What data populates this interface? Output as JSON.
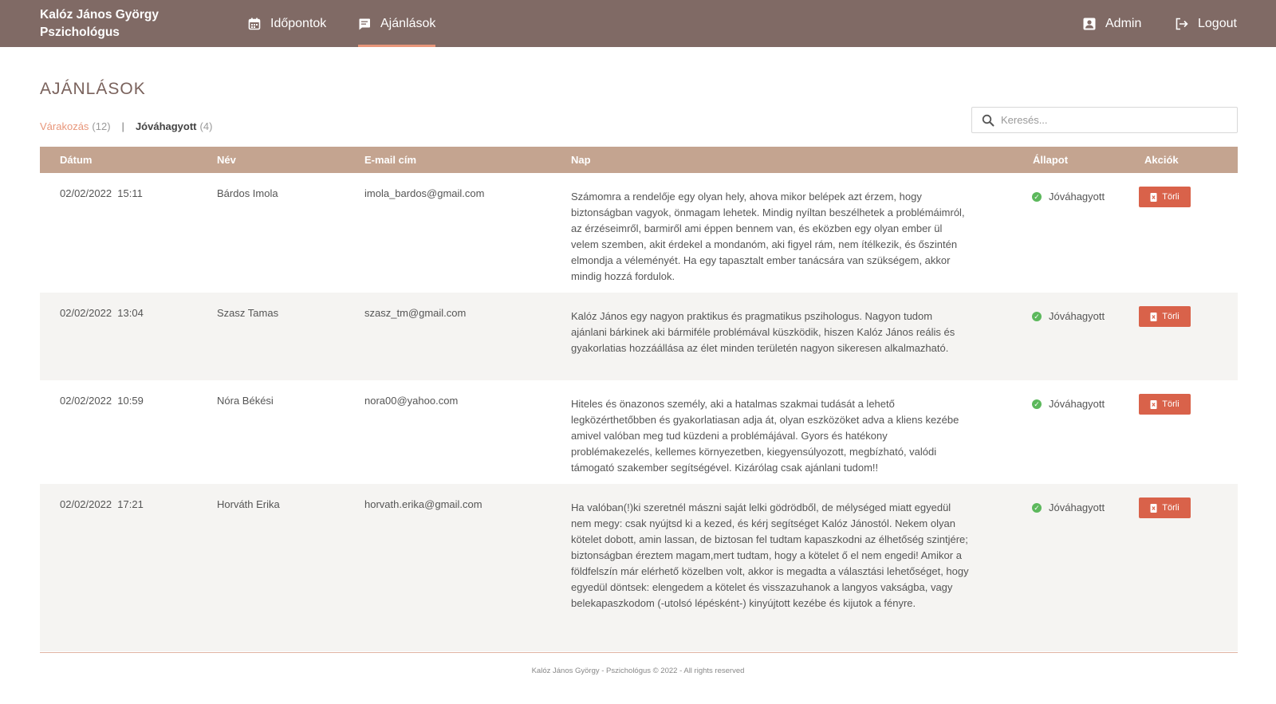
{
  "brand": {
    "line1": "Kalóz János György",
    "line2": "Pszichológus"
  },
  "nav": {
    "times": "Időpontok",
    "recommendations": "Ajánlások",
    "admin": "Admin",
    "logout": "Logout"
  },
  "page": {
    "title": "AJÁNLÁSOK"
  },
  "filters": {
    "waiting_label": "Várakozás",
    "waiting_count": "(12)",
    "separator": "|",
    "approved_label": "Jóváhagyott",
    "approved_count": "(4)"
  },
  "search": {
    "placeholder": "Keresés..."
  },
  "table": {
    "headers": {
      "date": "Dátum",
      "name": "Név",
      "email": "E-mail cím",
      "day": "Nap",
      "status": "Állapot",
      "actions": "Akciók"
    },
    "rows": [
      {
        "date": "02/02/2022  15:11",
        "name": "Bárdos Imola",
        "email": "imola_bardos@gmail.com",
        "day": "Számomra a rendelője egy olyan hely, ahova mikor belépek azt érzem, hogy biztonságban vagyok, önmagam lehetek. Mindig nyíltan beszélhetek a problémáimról, az érzéseimről, barmiről ami éppen bennem van, és eközben egy olyan ember ül velem szemben, akit érdekel a mondanóm, aki figyel rám, nem ítélkezik, és őszintén elmondja a véleményét. Ha egy tapasztalt ember tanácsára van szükségem, akkor mindig hozzá fordulok.",
        "status": "Jóváhagyott",
        "action": "Törli"
      },
      {
        "date": "02/02/2022  13:04",
        "name": "Szasz Tamas",
        "email": "szasz_tm@gmail.com",
        "day": "Kalóz János egy nagyon praktikus és pragmatikus pszihologus. Nagyon tudom ajánlani bárkinek aki bármiféle problémával küszködik, hiszen Kalóz János reális és gyakorlatias hozzáállása az élet minden területén nagyon sikeresen alkalmazható.",
        "status": "Jóváhagyott",
        "action": "Törli"
      },
      {
        "date": "02/02/2022  10:59",
        "name": "Nóra Békési",
        "email": "nora00@yahoo.com",
        "day": "Hiteles és önazonos személy, aki a hatalmas szakmai tudását a lehető legközérthetőbben és gyakorlatiasan adja át, olyan eszközöket adva a kliens kezébe amivel valóban meg tud küzdeni a problémájával. Gyors és hatékony problémakezelés, kellemes környezetben, kiegyensúlyozott, megbízható, valódi támogató szakember segítségével. Kizárólag csak ajánlani tudom!!",
        "status": "Jóváhagyott",
        "action": "Törli"
      },
      {
        "date": "02/02/2022  17:21",
        "name": "Horváth Erika",
        "email": "horvath.erika@gmail.com",
        "day": "Ha valóban(!)ki szeretnél mászni saját lelki gödrödből, de mélységed miatt egyedül nem megy: csak nyújtsd ki a kezed, és kérj segítséget Kalóz Jánostól. Nekem olyan kötelet dobott, amin lassan, de biztosan fel tudtam kapaszkodni az élhetőség szintjére; biztonságban éreztem magam,mert tudtam, hogy a kötelet ő el nem engedi! Amikor a földfelszín már elérhető közelben volt, akkor is megadta a választási lehetőséget, hogy egyedül döntsek: elengedem a kötelet és visszazuhanok a langyos vakságba, vagy belekapaszkodom (-utolsó lépésként-) kinyújtott kezébe és kijutok a fényre.",
        "status": "Jóváhagyott",
        "action": "Törli"
      }
    ]
  },
  "footer": {
    "text": "Kalóz János György - Pszichológus © 2022 - All rights reserved"
  },
  "colors": {
    "topbar": "#806a65",
    "accent": "#e8967a",
    "table_header": "#c4a490",
    "delete": "#d9624a",
    "approved": "#5cb85c"
  }
}
